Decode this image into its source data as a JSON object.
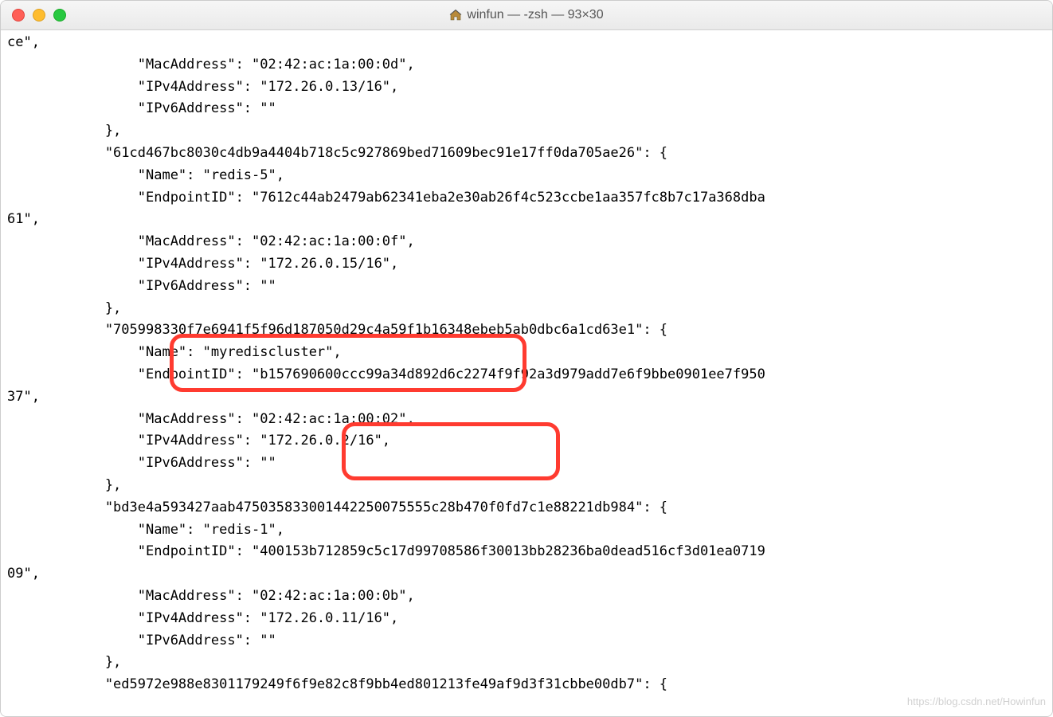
{
  "window": {
    "title": "winfun — -zsh — 93×30",
    "icon": "home-icon"
  },
  "traffic_lights": {
    "close": "close",
    "minimize": "minimize",
    "maximize": "maximize"
  },
  "terminal_lines": [
    "ce\",",
    "                \"MacAddress\": \"02:42:ac:1a:00:0d\",",
    "                \"IPv4Address\": \"172.26.0.13/16\",",
    "                \"IPv6Address\": \"\"",
    "            },",
    "            \"61cd467bc8030c4db9a4404b718c5c927869bed71609bec91e17ff0da705ae26\": {",
    "                \"Name\": \"redis-5\",",
    "                \"EndpointID\": \"7612c44ab2479ab62341eba2e30ab26f4c523ccbe1aa357fc8b7c17a368dba",
    "61\",",
    "                \"MacAddress\": \"02:42:ac:1a:00:0f\",",
    "                \"IPv4Address\": \"172.26.0.15/16\",",
    "                \"IPv6Address\": \"\"",
    "            },",
    "            \"705998330f7e6941f5f96d187050d29c4a59f1b16348ebeb5ab0dbc6a1cd63e1\": {",
    "                \"Name\": \"myrediscluster\",",
    "                \"EndpointID\": \"b157690600ccc99a34d892d6c2274f9f92a3d979add7e6f9bbe0901ee7f950",
    "37\",",
    "                \"MacAddress\": \"02:42:ac:1a:00:02\",",
    "                \"IPv4Address\": \"172.26.0.2/16\",",
    "                \"IPv6Address\": \"\"",
    "            },",
    "            \"bd3e4a593427aab475035833001442250075555c28b470f0fd7c1e88221db984\": {",
    "                \"Name\": \"redis-1\",",
    "                \"EndpointID\": \"400153b712859c5c17d99708586f30013bb28236ba0dead516cf3d01ea0719",
    "09\",",
    "                \"MacAddress\": \"02:42:ac:1a:00:0b\",",
    "                \"IPv4Address\": \"172.26.0.11/16\",",
    "                \"IPv6Address\": \"\"",
    "            },",
    "            \"ed5972e988e8301179249f6f9e82c8f9bb4ed801213fe49af9d3f31cbbe00db7\": {"
  ],
  "annotations": {
    "name_box": "highlight-name-myrediscluster",
    "ip_box": "highlight-ipv4-172.26.0.2/16"
  },
  "watermark": "https://blog.csdn.net/Howinfun",
  "json_values": {
    "container_a": {
      "MacAddress": "02:42:ac:1a:00:0d",
      "IPv4Address": "172.26.0.13/16",
      "IPv6Address": ""
    },
    "container_61cd467bc8030c4db9a4404b718c5c927869bed71609bec91e17ff0da705ae26": {
      "Name": "redis-5",
      "EndpointID": "7612c44ab2479ab62341eba2e30ab26f4c523ccbe1aa357fc8b7c17a368dba61",
      "MacAddress": "02:42:ac:1a:00:0f",
      "IPv4Address": "172.26.0.15/16",
      "IPv6Address": ""
    },
    "container_705998330f7e6941f5f96d187050d29c4a59f1b16348ebeb5ab0dbc6a1cd63e1": {
      "Name": "myrediscluster",
      "EndpointID": "b157690600ccc99a34d892d6c2274f9f92a3d979add7e6f9bbe0901ee7f95037",
      "MacAddress": "02:42:ac:1a:00:02",
      "IPv4Address": "172.26.0.2/16",
      "IPv6Address": ""
    },
    "container_bd3e4a593427aab475035833001442250075555c28b470f0fd7c1e88221db984": {
      "Name": "redis-1",
      "EndpointID": "400153b712859c5c17d99708586f30013bb28236ba0dead516cf3d01ea071909",
      "MacAddress": "02:42:ac:1a:00:0b",
      "IPv4Address": "172.26.0.11/16",
      "IPv6Address": ""
    },
    "container_ed5972e988e8301179249f6f9e82c8f9bb4ed801213fe49af9d3f31cbbe00db7": {}
  }
}
